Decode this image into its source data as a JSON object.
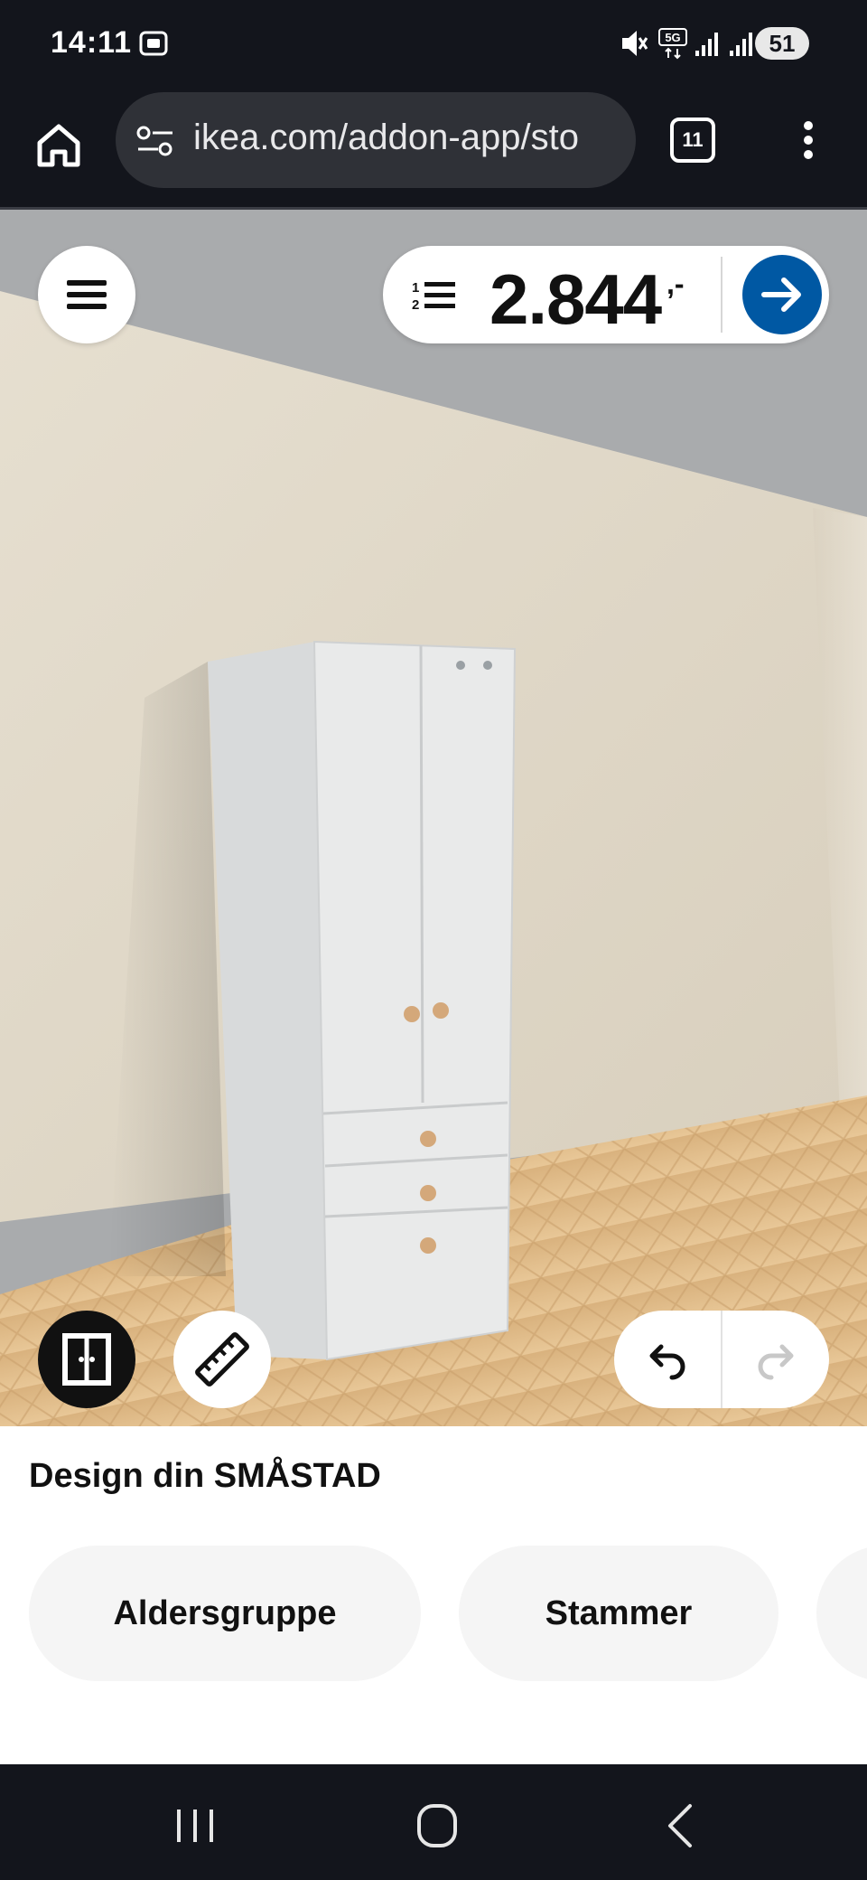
{
  "status_bar": {
    "time": "14:11",
    "network": "5G",
    "battery": "51"
  },
  "browser": {
    "url": "ikea.com/addon-app/sto",
    "tab_count": "11"
  },
  "planner": {
    "price": "2.844",
    "price_suffix": ",-",
    "accent_color": "#0058a3"
  },
  "panel": {
    "title": "Design din SMÅSTAD",
    "options": [
      "Aldersgruppe",
      "Stammer"
    ]
  }
}
